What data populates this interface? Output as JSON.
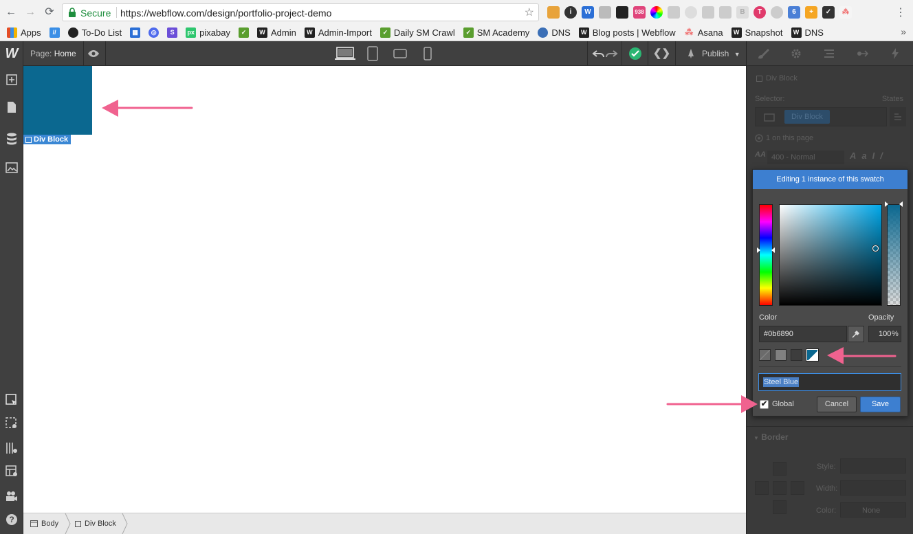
{
  "browser": {
    "secure_label": "Secure",
    "url": "https://webflow.com/design/portfolio-project-demo",
    "bookmarks": [
      {
        "label": "Apps",
        "color": "#e44d26"
      },
      {
        "label": "",
        "color": "#3a8ee6"
      },
      {
        "label": "",
        "color": "#222222"
      },
      {
        "label": "To-Do List",
        "color": ""
      },
      {
        "label": "",
        "color": "#2b6fd6"
      },
      {
        "label": "",
        "color": "#4f6bed"
      },
      {
        "label": "",
        "color": "#6c4fd8"
      },
      {
        "label": "pixabay",
        "color": "#2ec66e"
      },
      {
        "label": "",
        "color": "#5a9e2f"
      },
      {
        "label": "Admin",
        "color": "#222222"
      },
      {
        "label": "Admin-Import",
        "color": "#222222"
      },
      {
        "label": "Daily SM Crawl",
        "color": "#5a9e2f"
      },
      {
        "label": "SM Academy",
        "color": "#5a9e2f"
      },
      {
        "label": "DNS",
        "color": "#3b6fb6"
      },
      {
        "label": "Blog posts | Webflow",
        "color": "#222222"
      },
      {
        "label": "Asana",
        "color": "#f06a6a"
      },
      {
        "label": "Snapshot",
        "color": "#222222"
      },
      {
        "label": "DNS",
        "color": "#222222"
      }
    ],
    "bm_more": "»"
  },
  "toolbar": {
    "page_label": "Page:",
    "page_name": "Home",
    "publish_label": "Publish"
  },
  "canvas": {
    "element_label": "Div Block",
    "element_color": "#0b6890"
  },
  "breadcrumb": {
    "items": [
      "Body",
      "Div Block"
    ]
  },
  "panel": {
    "element_type": "Div Block",
    "selector_label": "Selector:",
    "states_label": "States",
    "selector_tag": "Div Block",
    "on_page": "1 on this page",
    "font_weight": "400 - Normal",
    "border_heading": "Border",
    "style_label": "Style:",
    "width_label": "Width:",
    "color_label": "Color:",
    "color_none": "None"
  },
  "swatch_popup": {
    "banner": "Editing 1 instance of this swatch",
    "color_label": "Color",
    "opacity_label": "Opacity",
    "hex_value": "#0b6890",
    "opacity_value": "100",
    "opacity_unit": "%",
    "swatch_name": "Steel Blue",
    "global_label": "Global",
    "global_checked": "✔",
    "cancel_label": "Cancel",
    "save_label": "Save"
  }
}
